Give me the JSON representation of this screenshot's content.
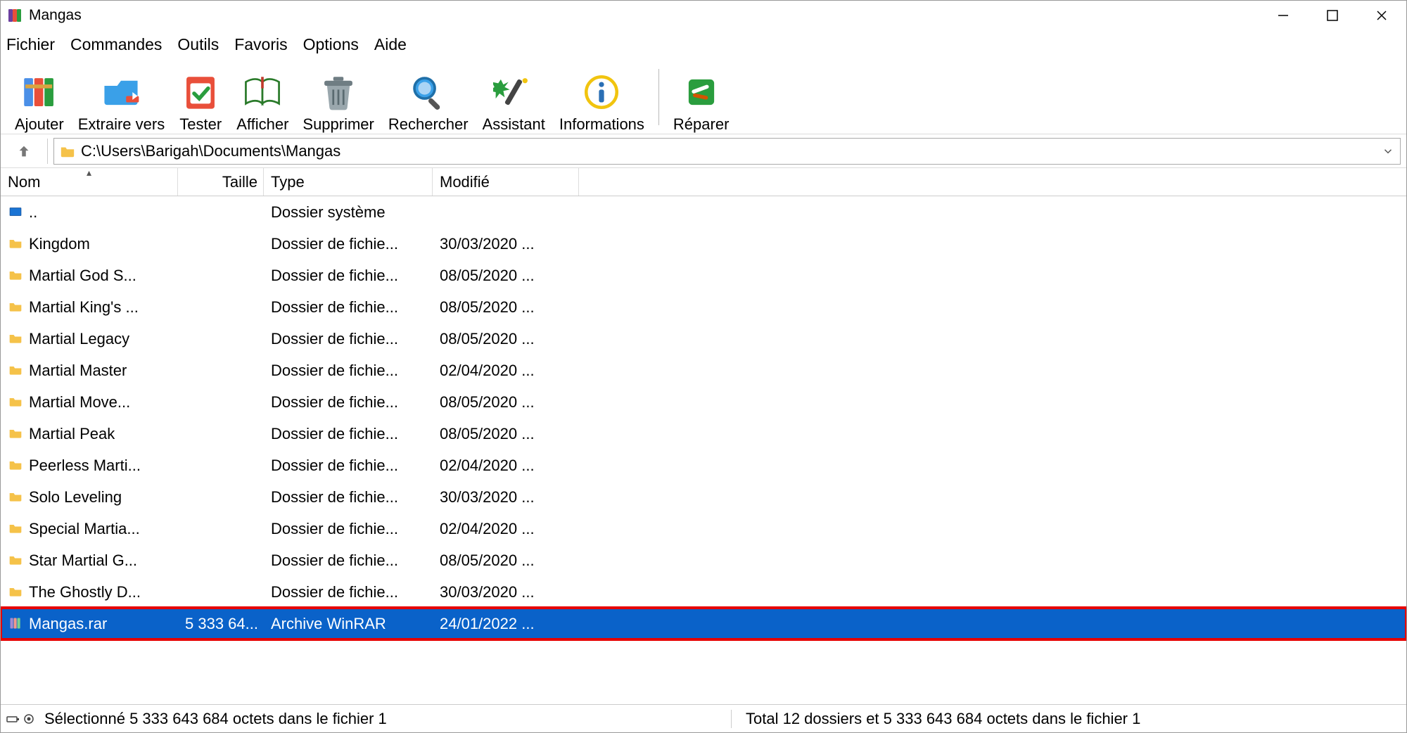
{
  "window": {
    "title": "Mangas",
    "minimize_glyph": "—",
    "maximize_glyph": "☐",
    "close_glyph": "✕"
  },
  "menu": [
    "Fichier",
    "Commandes",
    "Outils",
    "Favoris",
    "Options",
    "Aide"
  ],
  "toolbar": [
    {
      "id": "add",
      "label": "Ajouter",
      "icon": "books-icon"
    },
    {
      "id": "extract",
      "label": "Extraire vers",
      "icon": "folder-out-icon"
    },
    {
      "id": "test",
      "label": "Tester",
      "icon": "check-icon"
    },
    {
      "id": "view",
      "label": "Afficher",
      "icon": "book-open-icon"
    },
    {
      "id": "delete",
      "label": "Supprimer",
      "icon": "trash-icon"
    },
    {
      "id": "find",
      "label": "Rechercher",
      "icon": "search-icon"
    },
    {
      "id": "wizard",
      "label": "Assistant",
      "icon": "wand-icon"
    },
    {
      "id": "info",
      "label": "Informations",
      "icon": "info-icon"
    },
    {
      "id": "sep",
      "label": "",
      "icon": ""
    },
    {
      "id": "repair",
      "label": "Réparer",
      "icon": "repair-icon"
    }
  ],
  "path": "C:\\Users\\Barigah\\Documents\\Mangas",
  "columns": {
    "name": "Nom",
    "size": "Taille",
    "type": "Type",
    "modified": "Modifié"
  },
  "rows": [
    {
      "icon": "up-icon",
      "name": "..",
      "size": "",
      "type": "Dossier système",
      "date": "",
      "selected": false
    },
    {
      "icon": "folder-icon",
      "name": "Kingdom",
      "size": "",
      "type": "Dossier de fichie...",
      "date": "30/03/2020 ...",
      "selected": false
    },
    {
      "icon": "folder-icon",
      "name": "Martial God S...",
      "size": "",
      "type": "Dossier de fichie...",
      "date": "08/05/2020 ...",
      "selected": false
    },
    {
      "icon": "folder-icon",
      "name": "Martial King's ...",
      "size": "",
      "type": "Dossier de fichie...",
      "date": "08/05/2020 ...",
      "selected": false
    },
    {
      "icon": "folder-icon",
      "name": "Martial Legacy",
      "size": "",
      "type": "Dossier de fichie...",
      "date": "08/05/2020 ...",
      "selected": false
    },
    {
      "icon": "folder-icon",
      "name": "Martial Master",
      "size": "",
      "type": "Dossier de fichie...",
      "date": "02/04/2020 ...",
      "selected": false
    },
    {
      "icon": "folder-icon",
      "name": "Martial Move...",
      "size": "",
      "type": "Dossier de fichie...",
      "date": "08/05/2020 ...",
      "selected": false
    },
    {
      "icon": "folder-icon",
      "name": "Martial Peak",
      "size": "",
      "type": "Dossier de fichie...",
      "date": "08/05/2020 ...",
      "selected": false
    },
    {
      "icon": "folder-icon",
      "name": "Peerless Marti...",
      "size": "",
      "type": "Dossier de fichie...",
      "date": "02/04/2020 ...",
      "selected": false
    },
    {
      "icon": "folder-icon",
      "name": "Solo Leveling",
      "size": "",
      "type": "Dossier de fichie...",
      "date": "30/03/2020 ...",
      "selected": false
    },
    {
      "icon": "folder-icon",
      "name": "Special Martia...",
      "size": "",
      "type": "Dossier de fichie...",
      "date": "02/04/2020 ...",
      "selected": false
    },
    {
      "icon": "folder-icon",
      "name": "Star Martial G...",
      "size": "",
      "type": "Dossier de fichie...",
      "date": "08/05/2020 ...",
      "selected": false
    },
    {
      "icon": "folder-icon",
      "name": "The Ghostly D...",
      "size": "",
      "type": "Dossier de fichie...",
      "date": "30/03/2020 ...",
      "selected": false
    },
    {
      "icon": "rar-icon",
      "name": "Mangas.rar",
      "size": "5 333 64...",
      "type": "Archive WinRAR",
      "date": "24/01/2022 ...",
      "selected": true,
      "highlighted": true
    }
  ],
  "status": {
    "left": "Sélectionné 5 333 643 684 octets dans le fichier 1",
    "right": "Total 12 dossiers et 5 333 643 684 octets dans le fichier 1"
  }
}
